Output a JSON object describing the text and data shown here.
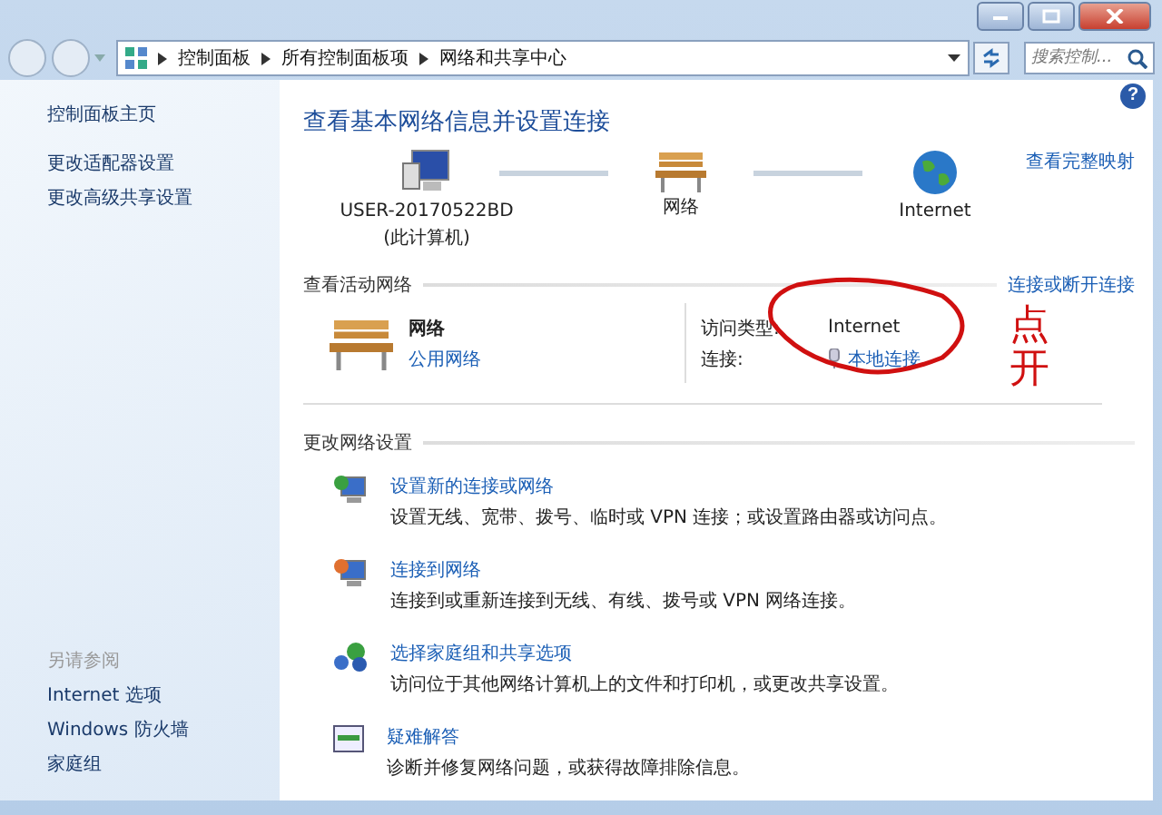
{
  "address_bar": {
    "breadcrumbs": [
      "控制面板",
      "所有控制面板项",
      "网络和共享中心"
    ]
  },
  "search": {
    "placeholder": "搜索控制..."
  },
  "help": "?",
  "sidebar": {
    "links": [
      "控制面板主页",
      "更改适配器设置",
      "更改高级共享设置"
    ],
    "see_also_title": "另请参阅",
    "see_also": [
      "Internet 选项",
      "Windows 防火墙",
      "家庭组"
    ]
  },
  "main": {
    "title": "查看基本网络信息并设置连接",
    "map": {
      "nodes": [
        {
          "kind": "computer",
          "label": "USER-20170522BD",
          "sublabel": "(此计算机)"
        },
        {
          "kind": "bench",
          "label": "网络"
        },
        {
          "kind": "globe",
          "label": "Internet"
        }
      ],
      "full_map_link": "查看完整映射"
    },
    "active_networks": {
      "heading": "查看活动网络",
      "action_link": "连接或断开连接",
      "network": {
        "name": "网络",
        "type_link": "公用网络",
        "access_label": "访问类型:",
        "access_value": "Internet",
        "connection_label": "连接:",
        "connection_link": "本地连接"
      }
    },
    "change_settings": {
      "heading": "更改网络设置",
      "tasks": [
        {
          "kind": "setup",
          "title": "设置新的连接或网络",
          "description": "设置无线、宽带、拨号、临时或 VPN 连接；或设置路由器或访问点。"
        },
        {
          "kind": "connect",
          "title": "连接到网络",
          "description": "连接到或重新连接到无线、有线、拨号或 VPN 网络连接。"
        },
        {
          "kind": "homegroup",
          "title": "选择家庭组和共享选项",
          "description": "访问位于其他网络计算机上的文件和打印机，或更改共享设置。"
        },
        {
          "kind": "troubleshoot",
          "title": "疑难解答",
          "description": "诊断并修复网络问题，或获得故障排除信息。"
        }
      ]
    }
  },
  "annotation": {
    "note": "点开"
  }
}
